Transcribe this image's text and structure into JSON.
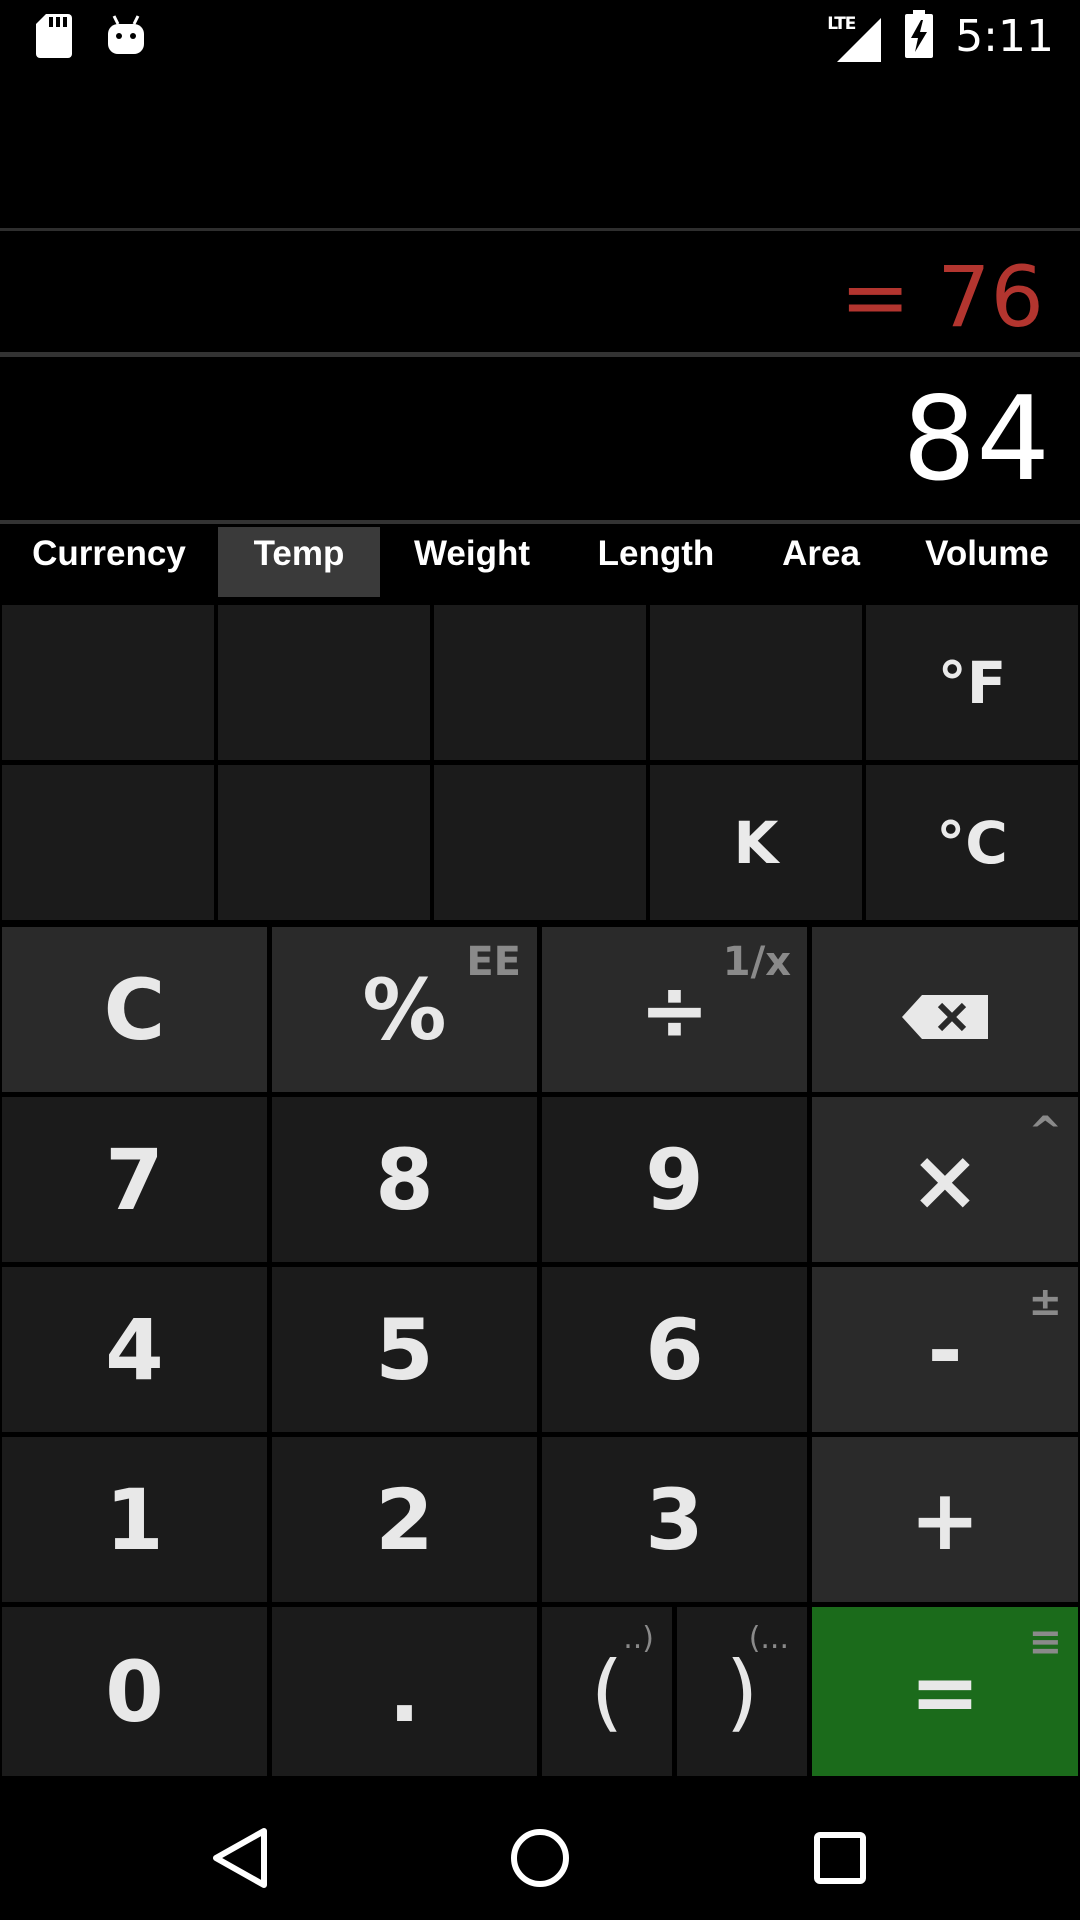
{
  "status_bar": {
    "time": "5:11",
    "network": "LTE",
    "icons": [
      "sd-card-icon",
      "android-debug-icon",
      "signal-icon",
      "battery-charging-icon"
    ]
  },
  "display": {
    "result": "= 76",
    "expression": "84"
  },
  "tabs": [
    {
      "label": "Currency",
      "active": false
    },
    {
      "label": "Temp",
      "active": true
    },
    {
      "label": "Weight",
      "active": false
    },
    {
      "label": "Length",
      "active": false
    },
    {
      "label": "Area",
      "active": false
    },
    {
      "label": "Volume",
      "active": false
    }
  ],
  "converter": {
    "row1": [
      "",
      "",
      "",
      "",
      "°F"
    ],
    "row2": [
      "",
      "",
      "",
      "K",
      "°C"
    ]
  },
  "keypad": {
    "clear": "C",
    "percent": "%",
    "percent_sub": "EE",
    "divide": "÷",
    "divide_sub": "1/x",
    "backspace_icon": "backspace-icon",
    "seven": "7",
    "eight": "8",
    "nine": "9",
    "multiply": "×",
    "multiply_sub": "^",
    "four": "4",
    "five": "5",
    "six": "6",
    "minus": "-",
    "minus_sub": "±",
    "one": "1",
    "two": "2",
    "three": "3",
    "plus": "+",
    "zero": "0",
    "dot": ".",
    "open_paren": "(",
    "open_paren_sub": "..)",
    "close_paren": ")",
    "close_paren_sub": "(...",
    "equals": "=",
    "equals_sub": "≡"
  },
  "colors": {
    "result": "#b3352f",
    "equals_key": "#1b6b1b",
    "active_tab": "#3a3a3a"
  },
  "nav_bar": [
    "back-icon",
    "home-icon",
    "recents-icon"
  ]
}
